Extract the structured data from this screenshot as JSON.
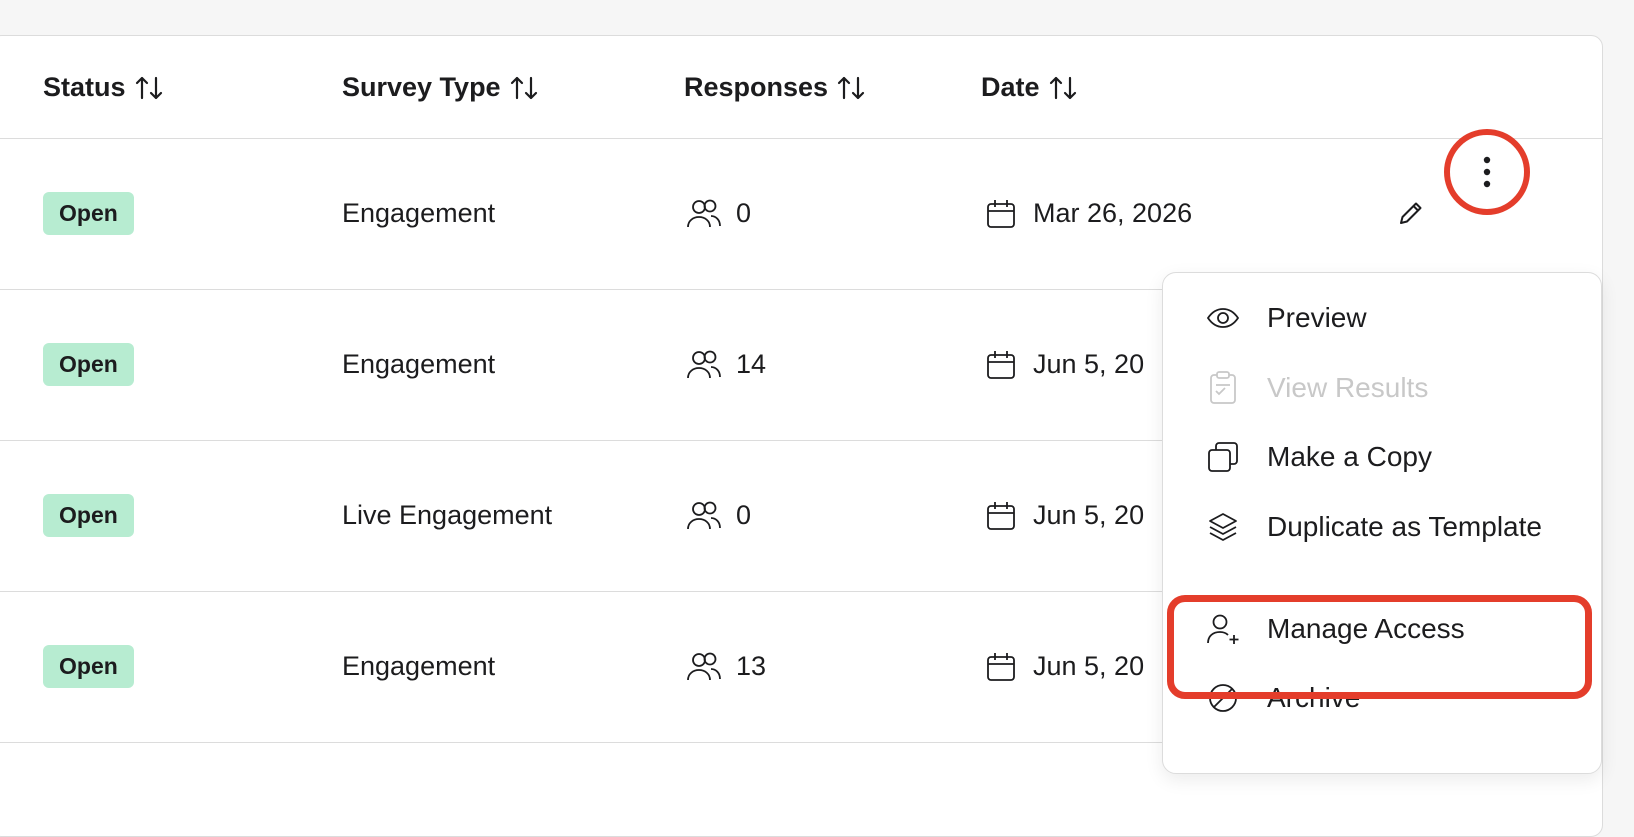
{
  "table": {
    "headers": {
      "status": "Status",
      "survey_type": "Survey Type",
      "responses": "Responses",
      "date": "Date"
    },
    "rows": [
      {
        "status": "Open",
        "survey_type": "Engagement",
        "responses": "0",
        "date": "Mar 26, 2026"
      },
      {
        "status": "Open",
        "survey_type": "Engagement",
        "responses": "14",
        "date": "Jun 5, 20"
      },
      {
        "status": "Open",
        "survey_type": "Live Engagement",
        "responses": "0",
        "date": "Jun 5, 20"
      },
      {
        "status": "Open",
        "survey_type": "Engagement",
        "responses": "13",
        "date": "Jun 5, 20"
      }
    ]
  },
  "menu": {
    "items": [
      {
        "label": "Preview",
        "icon": "eye-icon",
        "disabled": false
      },
      {
        "label": "View Results",
        "icon": "clipboard-check-icon",
        "disabled": true
      },
      {
        "label": "Make a Copy",
        "icon": "copy-icon",
        "disabled": false
      },
      {
        "label": "Duplicate as Template",
        "icon": "layers-icon",
        "disabled": false
      },
      {
        "label": "Manage Access",
        "icon": "user-plus-icon",
        "disabled": false
      },
      {
        "label": "Archive",
        "icon": "ban-icon",
        "disabled": false
      }
    ]
  },
  "colors": {
    "badge_bg": "#b7ecd1",
    "highlight": "#e43d2b",
    "border": "#dcdcdc",
    "disabled_text": "#c8c8c8"
  }
}
